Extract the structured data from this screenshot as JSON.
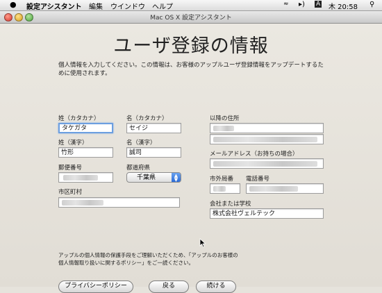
{
  "menubar": {
    "app_name": "設定アシスタント",
    "items": [
      "編集",
      "ウインドウ",
      "ヘルプ"
    ],
    "input_indicator": "A",
    "clock": "木 20:58"
  },
  "window": {
    "title": "Mac OS X 設定アシスタント"
  },
  "page": {
    "heading": "ユーザ登録の情報",
    "intro": "個人情報を入力してください。この情報は、お客様のアップルユーザ登録情報をアップデートするために使用されます。"
  },
  "form": {
    "last_name_kana": {
      "label": "姓（カタカナ）",
      "value": "タケガタ"
    },
    "first_name_kana": {
      "label": "名（カタカナ）",
      "value": "セイジ"
    },
    "last_name_kanji": {
      "label": "姓（漢字）",
      "value": "竹形"
    },
    "first_name_kanji": {
      "label": "名（漢字）",
      "value": "誠司"
    },
    "postal_code": {
      "label": "郵便番号",
      "value": ""
    },
    "prefecture": {
      "label": "都道府県",
      "value": "千葉県"
    },
    "city": {
      "label": "市区町村",
      "value": ""
    },
    "address": {
      "label": "以降の住所",
      "value": ""
    },
    "email": {
      "label": "メールアドレス（お持ちの場合）",
      "value": ""
    },
    "area_code": {
      "label": "市外局番",
      "value": ""
    },
    "phone": {
      "label": "電話番号",
      "value": ""
    },
    "company": {
      "label": "会社または学校",
      "value": "株式会社ヴェルテック"
    }
  },
  "footer": {
    "note": "アップルの個人情報の保護手段をご理解いただくため、「アップルのお客様の個人情報取り扱いに関するポリシー」をご一読ください。",
    "privacy_button": "プライバシーポリシー",
    "back_button": "戻る",
    "continue_button": "続ける"
  }
}
